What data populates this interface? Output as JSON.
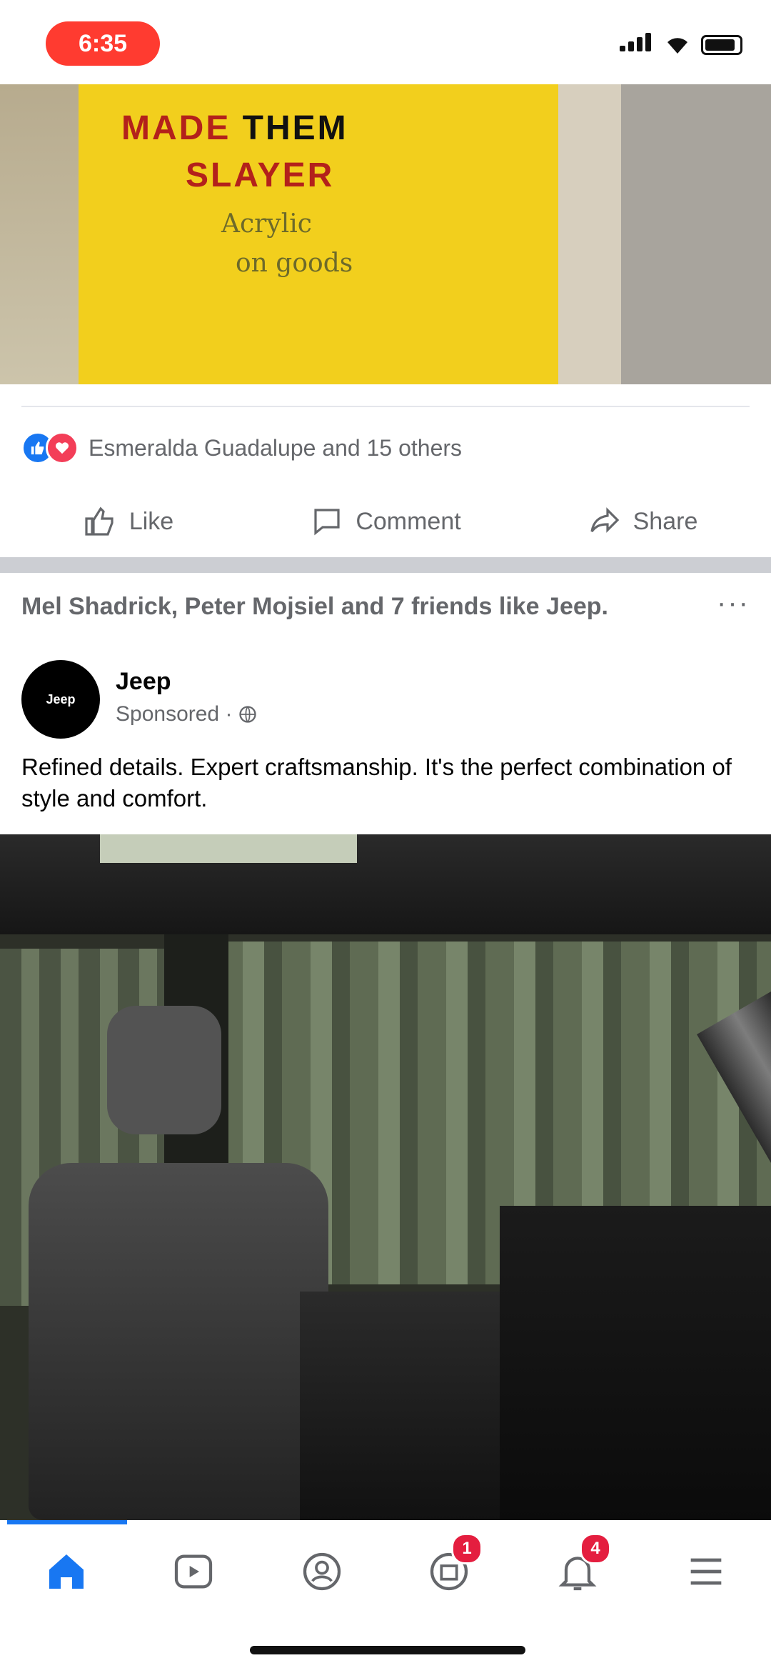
{
  "status_bar": {
    "time": "6:35"
  },
  "post1": {
    "image_sign": {
      "line1a": "MADE",
      "line1b": "THEM",
      "line2": "SLAYER",
      "line3": "Acrylic",
      "line4": "on goods"
    },
    "reactions_text": "Esmeralda Guadalupe and 15 others",
    "actions": {
      "like": "Like",
      "comment": "Comment",
      "share": "Share"
    }
  },
  "post2": {
    "context_line": "Mel Shadrick, Peter Mojsiel and 7 friends like Jeep.",
    "more": "···",
    "page_name": "Jeep",
    "avatar_text": "Jeep",
    "sponsored": "Sponsored · ",
    "body": "Refined details. Expert craftsmanship. It's the perfect combination of style and comfort."
  },
  "bottom_nav": {
    "items": [
      {
        "icon": "home-icon",
        "active": true
      },
      {
        "icon": "watch-icon"
      },
      {
        "icon": "groups-icon"
      },
      {
        "icon": "marketplace-icon",
        "badge": "1"
      },
      {
        "icon": "notifications-icon",
        "badge": "4"
      },
      {
        "icon": "menu-icon"
      }
    ]
  },
  "colors": {
    "accent": "#1877f2",
    "badge": "#e41e3f",
    "time_pill": "#ff3b30"
  }
}
